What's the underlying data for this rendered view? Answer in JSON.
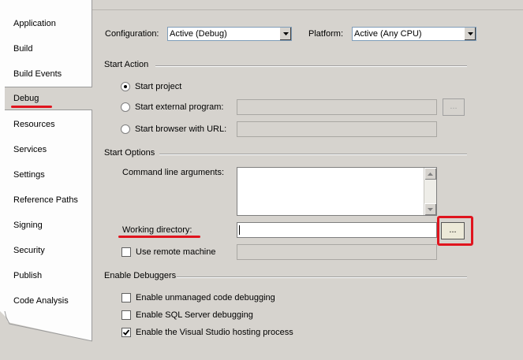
{
  "sidebar": {
    "items": [
      {
        "label": "Application"
      },
      {
        "label": "Build"
      },
      {
        "label": "Build Events"
      },
      {
        "label": "Debug"
      },
      {
        "label": "Resources"
      },
      {
        "label": "Services"
      },
      {
        "label": "Settings"
      },
      {
        "label": "Reference Paths"
      },
      {
        "label": "Signing"
      },
      {
        "label": "Security"
      },
      {
        "label": "Publish"
      },
      {
        "label": "Code Analysis"
      }
    ]
  },
  "header": {
    "configuration_label": "Configuration:",
    "configuration_value": "Active (Debug)",
    "platform_label": "Platform:",
    "platform_value": "Active (Any CPU)"
  },
  "start_action": {
    "title": "Start Action",
    "start_project": "Start project",
    "start_external": "Start external program:",
    "start_browser": "Start browser with URL:",
    "browse_label": "..."
  },
  "start_options": {
    "title": "Start Options",
    "cmd_args_label": "Command line arguments:",
    "working_dir_label": "Working directory:",
    "working_dir_value": "",
    "browse_label": "...",
    "remote_label": "Use remote machine"
  },
  "debuggers": {
    "title": "Enable Debuggers",
    "unmanaged": "Enable unmanaged code debugging",
    "sql": "Enable SQL Server debugging",
    "vshost": "Enable the Visual Studio hosting process"
  },
  "colors": {
    "highlight": "#e0141e",
    "background": "#d6d3ce"
  }
}
